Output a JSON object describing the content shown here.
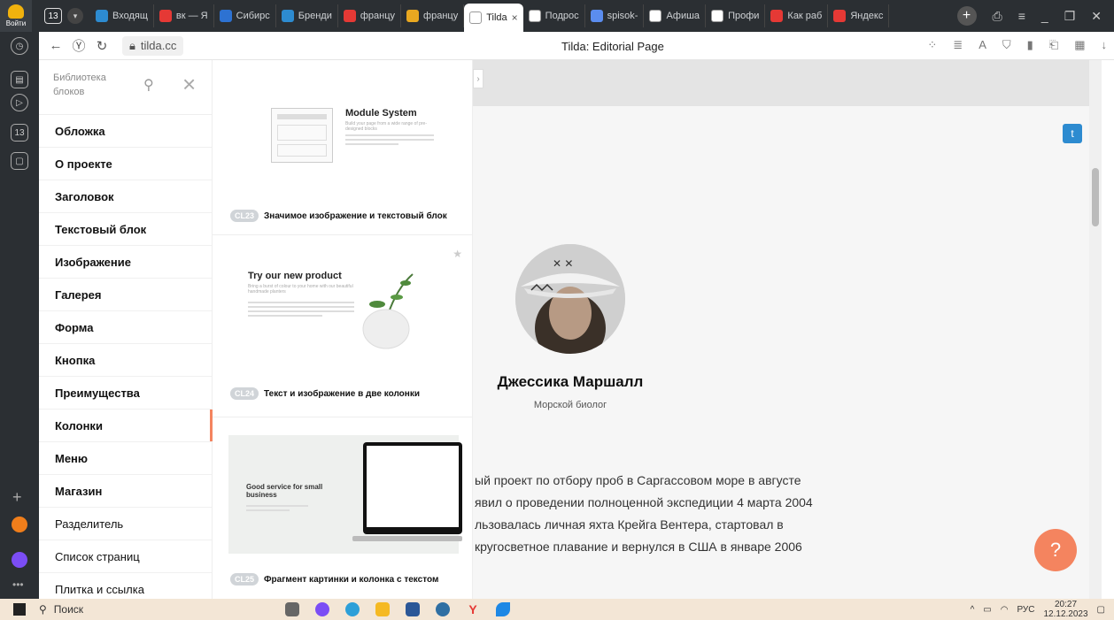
{
  "browser": {
    "account_label": "Войти",
    "tab_count": "13",
    "tabs": [
      {
        "label": "Входящ",
        "color": "#2d8bd0"
      },
      {
        "label": "вк — Я",
        "color": "#e53935"
      },
      {
        "label": "Сибирс",
        "color": "#2d72d2"
      },
      {
        "label": "Бренди",
        "color": "#2d8bd0"
      },
      {
        "label": "францу",
        "color": "#e53935"
      },
      {
        "label": "францу",
        "color": "#e9a820"
      },
      {
        "label": "Tilda",
        "color": "#ffffff",
        "active": true
      },
      {
        "label": "Подрос",
        "color": "#ffffff"
      },
      {
        "label": "spisok-",
        "color": "#5b8def"
      },
      {
        "label": "Афиша",
        "color": "#ffffff"
      },
      {
        "label": "Профи",
        "color": "#ffffff"
      },
      {
        "label": "Как раб",
        "color": "#e53935"
      },
      {
        "label": "Яндекс",
        "color": "#e53935"
      }
    ],
    "url": "tilda.cc",
    "page_title": "Tilda: Editorial Page"
  },
  "library": {
    "title": "Библиотека блоков",
    "categories": [
      {
        "label": "Обложка"
      },
      {
        "label": "О проекте"
      },
      {
        "label": "Заголовок"
      },
      {
        "label": "Текстовый блок"
      },
      {
        "label": "Изображение"
      },
      {
        "label": "Галерея"
      },
      {
        "label": "Форма"
      },
      {
        "label": "Кнопка"
      },
      {
        "label": "Преимущества"
      },
      {
        "label": "Колонки",
        "active": true
      },
      {
        "label": "Меню"
      },
      {
        "label": "Магазин"
      },
      {
        "label": "Разделитель"
      },
      {
        "label": "Список страниц"
      },
      {
        "label": "Плитка и ссылка"
      }
    ]
  },
  "blocks": [
    {
      "code": "CL23",
      "label": "Значимое изображение и текстовый блок",
      "preview_title": "Module System",
      "preview_sub": "Build your page from a wide range of pre-designed blocks"
    },
    {
      "code": "CL24",
      "label": "Текст и изображение в две колонки",
      "preview_title": "Try our new product",
      "preview_sub": "Bring a burst of colour to your home with our beautiful handmade planters"
    },
    {
      "code": "CL25",
      "label": "Фрагмент картинки и колонка с текстом",
      "preview_title": "Good service for small business"
    }
  ],
  "page": {
    "person_name": "Джессика Маршалл",
    "person_role": "Морской биолог",
    "paragraph": [
      "ый проект по отбору проб в Саргассовом море в августе",
      "явил о проведении полноценной экспедиции 4 марта 2004",
      "льзовалась личная яхта Крейга Вентера, стартовал в",
      " кругосветное плавание и вернулся в США в январе 2006"
    ],
    "help_label": "?"
  },
  "taskbar": {
    "search_label": "Поиск",
    "lang": "РУС",
    "time": "20:27",
    "date": "12.12.2023"
  },
  "colors": {
    "accent": "#f4845f",
    "twitter": "#2d8bd0"
  }
}
